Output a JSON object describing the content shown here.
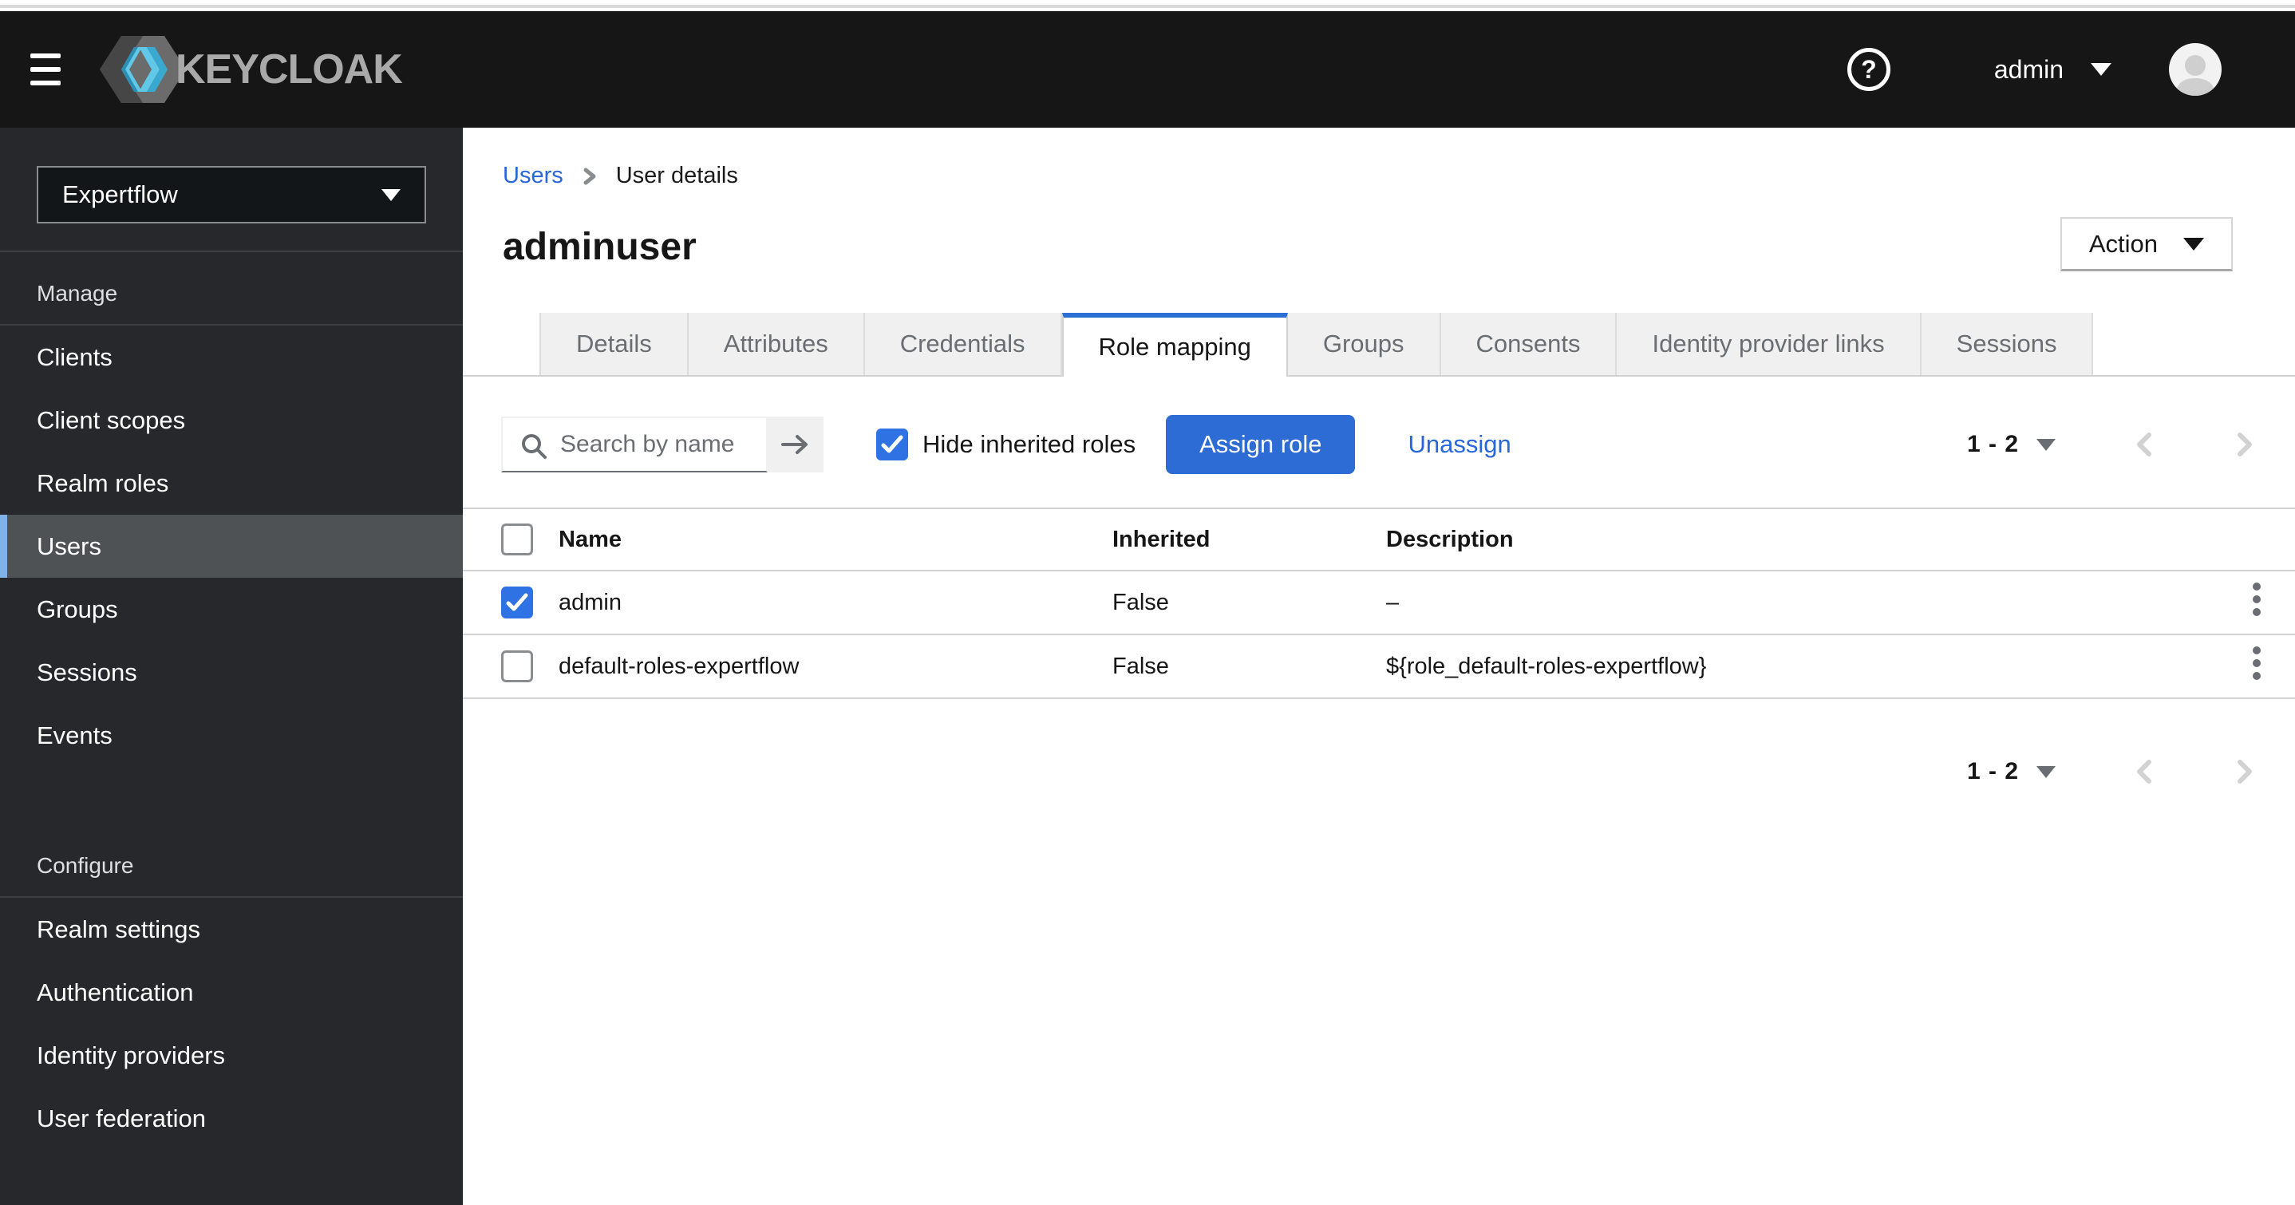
{
  "masthead": {
    "brand": "KEYCLOAK",
    "user_name": "admin"
  },
  "sidebar": {
    "realm": "Expertflow",
    "groups": [
      {
        "label": "Manage",
        "items": [
          {
            "label": "Clients"
          },
          {
            "label": "Client scopes"
          },
          {
            "label": "Realm roles"
          },
          {
            "label": "Users",
            "current": true
          },
          {
            "label": "Groups"
          },
          {
            "label": "Sessions"
          },
          {
            "label": "Events"
          }
        ]
      },
      {
        "label": "Configure",
        "items": [
          {
            "label": "Realm settings"
          },
          {
            "label": "Authentication"
          },
          {
            "label": "Identity providers"
          },
          {
            "label": "User federation"
          }
        ]
      }
    ]
  },
  "breadcrumb": {
    "link": "Users",
    "current": "User details"
  },
  "page": {
    "title": "adminuser",
    "action_label": "Action"
  },
  "tabs": [
    {
      "label": "Details"
    },
    {
      "label": "Attributes"
    },
    {
      "label": "Credentials"
    },
    {
      "label": "Role mapping",
      "active": true
    },
    {
      "label": "Groups"
    },
    {
      "label": "Consents"
    },
    {
      "label": "Identity provider links"
    },
    {
      "label": "Sessions"
    }
  ],
  "toolbar": {
    "search_placeholder": "Search by name",
    "hide_inherited_label": "Hide inherited roles",
    "hide_inherited_checked": true,
    "assign_label": "Assign role",
    "unassign_label": "Unassign"
  },
  "pagination": {
    "range": "1 - 2"
  },
  "table": {
    "headers": {
      "name": "Name",
      "inherited": "Inherited",
      "description": "Description"
    },
    "rows": [
      {
        "checked": true,
        "name": "admin",
        "inherited": "False",
        "description": "–"
      },
      {
        "checked": false,
        "name": "default-roles-expertflow",
        "inherited": "False",
        "description": "${role_default-roles-expertflow}"
      }
    ]
  },
  "colors": {
    "primary_blue": "#2c6cd4",
    "link_blue": "#2767d9",
    "checkbox_blue": "#2e72e4",
    "active_tab_accent": "#2b6fd4",
    "sidebar_current_accent": "#7fb2e8",
    "masthead_bg": "#161616",
    "sidebar_bg": "#26282b",
    "logo_cyan": "#3db1d8"
  }
}
